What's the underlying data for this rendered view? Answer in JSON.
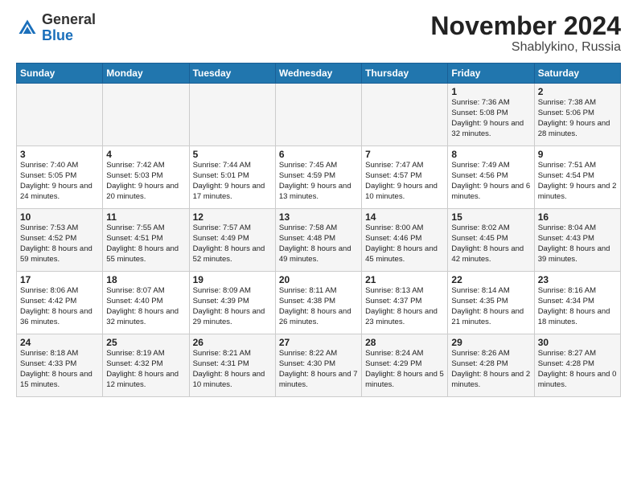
{
  "header": {
    "logo_general": "General",
    "logo_blue": "Blue",
    "month_title": "November 2024",
    "location": "Shablykino, Russia"
  },
  "weekdays": [
    "Sunday",
    "Monday",
    "Tuesday",
    "Wednesday",
    "Thursday",
    "Friday",
    "Saturday"
  ],
  "weeks": [
    [
      {
        "day": "",
        "info": ""
      },
      {
        "day": "",
        "info": ""
      },
      {
        "day": "",
        "info": ""
      },
      {
        "day": "",
        "info": ""
      },
      {
        "day": "",
        "info": ""
      },
      {
        "day": "1",
        "info": "Sunrise: 7:36 AM\nSunset: 5:08 PM\nDaylight: 9 hours and 32 minutes."
      },
      {
        "day": "2",
        "info": "Sunrise: 7:38 AM\nSunset: 5:06 PM\nDaylight: 9 hours and 28 minutes."
      }
    ],
    [
      {
        "day": "3",
        "info": "Sunrise: 7:40 AM\nSunset: 5:05 PM\nDaylight: 9 hours and 24 minutes."
      },
      {
        "day": "4",
        "info": "Sunrise: 7:42 AM\nSunset: 5:03 PM\nDaylight: 9 hours and 20 minutes."
      },
      {
        "day": "5",
        "info": "Sunrise: 7:44 AM\nSunset: 5:01 PM\nDaylight: 9 hours and 17 minutes."
      },
      {
        "day": "6",
        "info": "Sunrise: 7:45 AM\nSunset: 4:59 PM\nDaylight: 9 hours and 13 minutes."
      },
      {
        "day": "7",
        "info": "Sunrise: 7:47 AM\nSunset: 4:57 PM\nDaylight: 9 hours and 10 minutes."
      },
      {
        "day": "8",
        "info": "Sunrise: 7:49 AM\nSunset: 4:56 PM\nDaylight: 9 hours and 6 minutes."
      },
      {
        "day": "9",
        "info": "Sunrise: 7:51 AM\nSunset: 4:54 PM\nDaylight: 9 hours and 2 minutes."
      }
    ],
    [
      {
        "day": "10",
        "info": "Sunrise: 7:53 AM\nSunset: 4:52 PM\nDaylight: 8 hours and 59 minutes."
      },
      {
        "day": "11",
        "info": "Sunrise: 7:55 AM\nSunset: 4:51 PM\nDaylight: 8 hours and 55 minutes."
      },
      {
        "day": "12",
        "info": "Sunrise: 7:57 AM\nSunset: 4:49 PM\nDaylight: 8 hours and 52 minutes."
      },
      {
        "day": "13",
        "info": "Sunrise: 7:58 AM\nSunset: 4:48 PM\nDaylight: 8 hours and 49 minutes."
      },
      {
        "day": "14",
        "info": "Sunrise: 8:00 AM\nSunset: 4:46 PM\nDaylight: 8 hours and 45 minutes."
      },
      {
        "day": "15",
        "info": "Sunrise: 8:02 AM\nSunset: 4:45 PM\nDaylight: 8 hours and 42 minutes."
      },
      {
        "day": "16",
        "info": "Sunrise: 8:04 AM\nSunset: 4:43 PM\nDaylight: 8 hours and 39 minutes."
      }
    ],
    [
      {
        "day": "17",
        "info": "Sunrise: 8:06 AM\nSunset: 4:42 PM\nDaylight: 8 hours and 36 minutes."
      },
      {
        "day": "18",
        "info": "Sunrise: 8:07 AM\nSunset: 4:40 PM\nDaylight: 8 hours and 32 minutes."
      },
      {
        "day": "19",
        "info": "Sunrise: 8:09 AM\nSunset: 4:39 PM\nDaylight: 8 hours and 29 minutes."
      },
      {
        "day": "20",
        "info": "Sunrise: 8:11 AM\nSunset: 4:38 PM\nDaylight: 8 hours and 26 minutes."
      },
      {
        "day": "21",
        "info": "Sunrise: 8:13 AM\nSunset: 4:37 PM\nDaylight: 8 hours and 23 minutes."
      },
      {
        "day": "22",
        "info": "Sunrise: 8:14 AM\nSunset: 4:35 PM\nDaylight: 8 hours and 21 minutes."
      },
      {
        "day": "23",
        "info": "Sunrise: 8:16 AM\nSunset: 4:34 PM\nDaylight: 8 hours and 18 minutes."
      }
    ],
    [
      {
        "day": "24",
        "info": "Sunrise: 8:18 AM\nSunset: 4:33 PM\nDaylight: 8 hours and 15 minutes."
      },
      {
        "day": "25",
        "info": "Sunrise: 8:19 AM\nSunset: 4:32 PM\nDaylight: 8 hours and 12 minutes."
      },
      {
        "day": "26",
        "info": "Sunrise: 8:21 AM\nSunset: 4:31 PM\nDaylight: 8 hours and 10 minutes."
      },
      {
        "day": "27",
        "info": "Sunrise: 8:22 AM\nSunset: 4:30 PM\nDaylight: 8 hours and 7 minutes."
      },
      {
        "day": "28",
        "info": "Sunrise: 8:24 AM\nSunset: 4:29 PM\nDaylight: 8 hours and 5 minutes."
      },
      {
        "day": "29",
        "info": "Sunrise: 8:26 AM\nSunset: 4:28 PM\nDaylight: 8 hours and 2 minutes."
      },
      {
        "day": "30",
        "info": "Sunrise: 8:27 AM\nSunset: 4:28 PM\nDaylight: 8 hours and 0 minutes."
      }
    ]
  ]
}
